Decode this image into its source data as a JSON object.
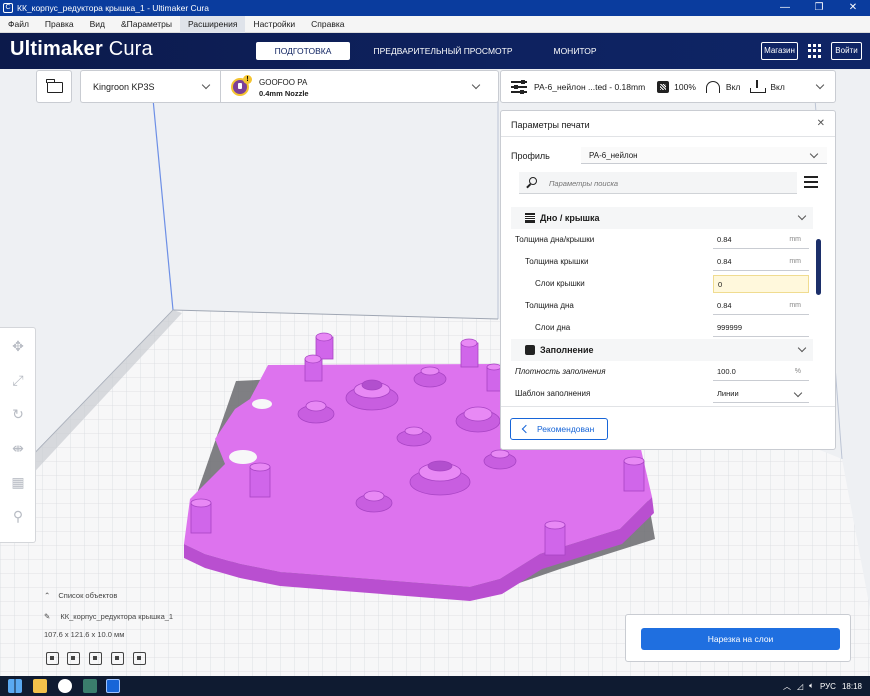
{
  "window": {
    "title": "КК_корпус_редуктора крышка_1 - Ultimaker Cura",
    "controls": [
      "—",
      "❐",
      "✕"
    ]
  },
  "menu": [
    "Файл",
    "Правка",
    "Вид",
    "&Параметры",
    "Расширения",
    "Настройки",
    "Справка"
  ],
  "header": {
    "logo_bold": "Ultimaker",
    "logo_light": " Cura",
    "tabs": [
      "ПОДГОТОВКА",
      "ПРЕДВАРИТЕЛЬНЫЙ ПРОСМОТР",
      "МОНИТОР"
    ],
    "shop_label": "Магазин",
    "login_label": "Войти"
  },
  "toolbar": {
    "machine": "Kingroon KP3S",
    "material_name": "GOOFOO PA",
    "nozzle": "0.4mm Nozzle",
    "profile_summary": "PA-6_нейлон ...ted - 0.18mm",
    "infill": "100%",
    "support": "Вкл",
    "adhesion": "Вкл"
  },
  "print_settings": {
    "title": "Параметры печати",
    "profile_label": "Профиль",
    "profile_value": "PA-6_нейлон",
    "search_placeholder": "Параметры поиска",
    "categories": [
      {
        "name": "Дно / крышка",
        "rows": [
          {
            "name": "Толщина дна/крышки",
            "value": "0.84",
            "unit": "mm"
          },
          {
            "name": "Толщина крышки",
            "value": "0.84",
            "unit": "mm"
          },
          {
            "name": "Слои крышки",
            "value": "0",
            "unit": ""
          },
          {
            "name": "Толщина дна",
            "value": "0.84",
            "unit": "mm"
          },
          {
            "name": "Слои дна",
            "value": "999999",
            "unit": ""
          }
        ]
      },
      {
        "name": "Заполнение",
        "rows": [
          {
            "name": "Плотность заполнения",
            "value": "100.0",
            "unit": "%"
          },
          {
            "name": "Шаблон заполнения",
            "value": "Линии",
            "unit": ""
          }
        ]
      }
    ],
    "recommended_label": "Рекомендован"
  },
  "object_list": {
    "header": "Список объектов",
    "item": "КК_корпус_редуктора крышка_1",
    "dimensions": "107.6 x 121.6 x 10.0 мм"
  },
  "slice_button": "Нарезка на слои",
  "taskbar": {
    "lang": "РУС",
    "time": "18:18"
  },
  "colors": {
    "header_bg": "#0e2260",
    "accent": "#1f6fe0",
    "model": "#dd73ee",
    "highlight_field": "#fff8dc"
  }
}
